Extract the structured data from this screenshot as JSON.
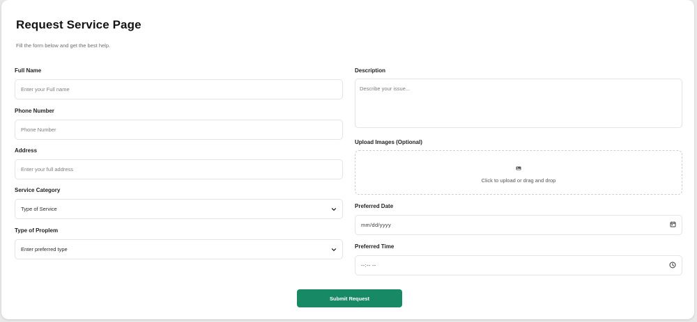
{
  "page": {
    "title": "Request Service Page",
    "subtitle": "Fill the form below and get the best help."
  },
  "form": {
    "full_name": {
      "label": "Full Name",
      "placeholder": "Enter your Full name"
    },
    "phone": {
      "label": "Phone Number",
      "placeholder": "Phone Number"
    },
    "address": {
      "label": "Address",
      "placeholder": "Enter your full address"
    },
    "service_category": {
      "label": "Service Category",
      "selected": "Type of Service"
    },
    "problem_type": {
      "label": "Type of Proplem",
      "selected": "Enter preferred type"
    },
    "description": {
      "label": "Description",
      "placeholder": "Describe your issue..."
    },
    "upload": {
      "label": "Upload Images (Optional)",
      "text": "Click to upload or drag and drop"
    },
    "preferred_date": {
      "label": "Preferred Date",
      "value": "mm/dd/yyyy"
    },
    "preferred_time": {
      "label": "Preferred Time",
      "value": "--:-- --"
    },
    "submit_label": "Submit Request"
  },
  "colors": {
    "accent": "#178a65",
    "card_background": "#ffffff",
    "page_background": "#e9e9e9"
  },
  "icons": {
    "select_arrow": "chevron-down-icon",
    "upload": "image-icon",
    "date": "calendar-icon",
    "time": "clock-icon"
  }
}
